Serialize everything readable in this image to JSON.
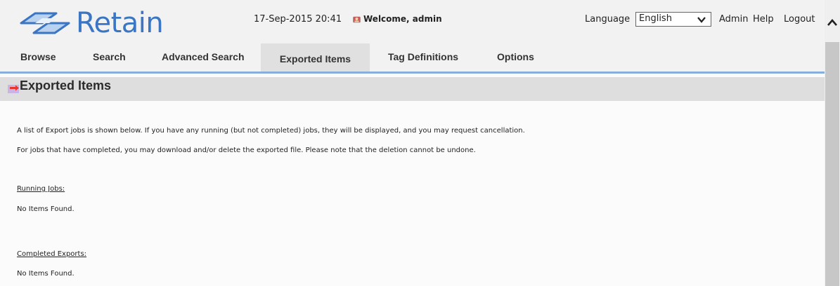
{
  "header": {
    "logo_text": "Retain",
    "datetime": "17-Sep-2015 20:41",
    "welcome": "Welcome, admin",
    "language_label": "Language",
    "language_value": "English",
    "admin_link": "Admin",
    "help_link": "Help",
    "logout_link": "Logout",
    "brand_color": "#3a76c4"
  },
  "tabs": [
    {
      "label": "Browse"
    },
    {
      "label": "Search"
    },
    {
      "label": "Advanced Search"
    },
    {
      "label": "Exported Items",
      "active": true
    },
    {
      "label": "Tag Definitions"
    },
    {
      "label": "Options"
    }
  ],
  "page": {
    "title": "Exported Items",
    "intro_1": "A list of Export jobs is shown below. If you have any running (but not completed) jobs, they will be displayed, and you may request cancellation.",
    "intro_2": "For jobs that have completed, you may download and/or delete the exported file. Please note that the deletion cannot be undone.",
    "running_heading": "Running Jobs:",
    "running_empty": "No Items Found.",
    "completed_heading": "Completed Exports:",
    "completed_empty": "No Items Found."
  }
}
